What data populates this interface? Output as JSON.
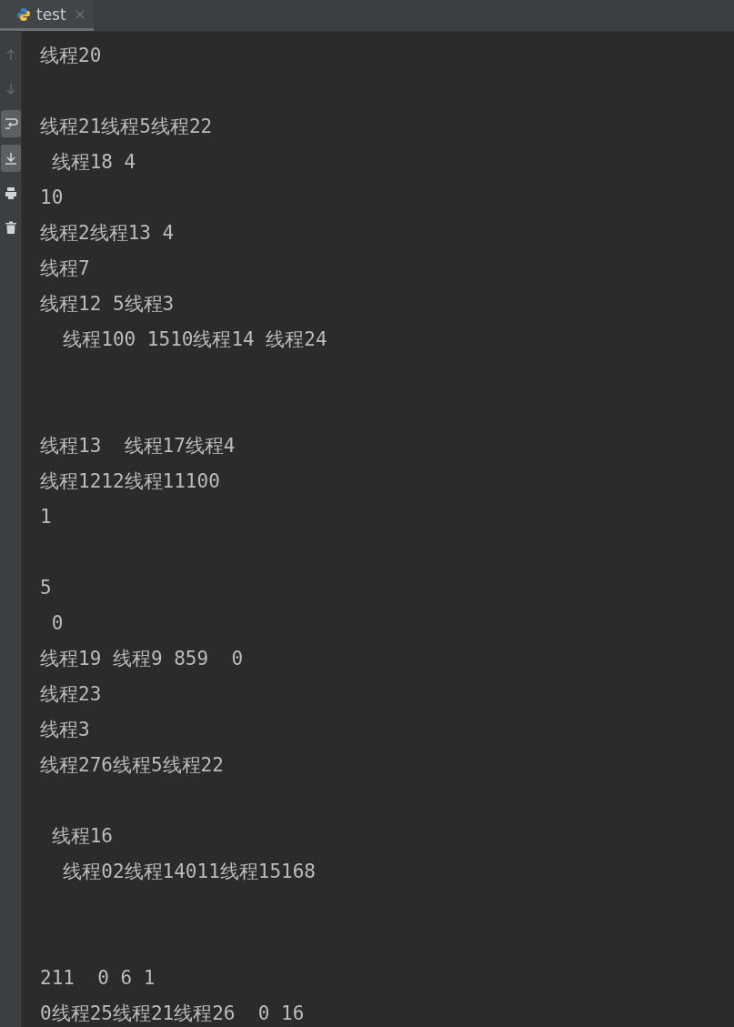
{
  "tab": {
    "label": "test",
    "selected": true
  },
  "toolbar": [
    {
      "kind": "up",
      "disabled": true,
      "on": false
    },
    {
      "kind": "down",
      "disabled": true,
      "on": false
    },
    {
      "kind": "wrap",
      "disabled": false,
      "on": true
    },
    {
      "kind": "scroll-end",
      "disabled": false,
      "on": true
    },
    {
      "kind": "print",
      "disabled": false,
      "on": false
    },
    {
      "kind": "delete",
      "disabled": false,
      "on": false
    }
  ],
  "lines": [
    {
      "kind": "text",
      "text": "线程20"
    },
    {
      "kind": "blank"
    },
    {
      "kind": "text",
      "text": "线程21线程5线程22"
    },
    {
      "kind": "text",
      "text": " 线程18 4"
    },
    {
      "kind": "text",
      "text": "10"
    },
    {
      "kind": "text",
      "text": "线程2线程13 4"
    },
    {
      "kind": "text",
      "text": "线程7"
    },
    {
      "kind": "text",
      "text": "线程12 5线程3"
    },
    {
      "kind": "text",
      "text": "  线程100 1510线程14 线程24"
    },
    {
      "kind": "blank"
    },
    {
      "kind": "blank"
    },
    {
      "kind": "text",
      "text": "线程13  线程17线程4"
    },
    {
      "kind": "text",
      "text": "线程1212线程11100"
    },
    {
      "kind": "text",
      "text": "1"
    },
    {
      "kind": "blank"
    },
    {
      "kind": "text",
      "text": "5"
    },
    {
      "kind": "text",
      "text": " 0"
    },
    {
      "kind": "text",
      "text": "线程19 线程9 859  0"
    },
    {
      "kind": "text",
      "text": "线程23"
    },
    {
      "kind": "text",
      "text": "线程3"
    },
    {
      "kind": "text",
      "text": "线程276线程5线程22"
    },
    {
      "kind": "blank"
    },
    {
      "kind": "text",
      "text": " 线程16"
    },
    {
      "kind": "text",
      "text": "  线程02线程14011线程15168"
    },
    {
      "kind": "blank"
    },
    {
      "kind": "blank"
    },
    {
      "kind": "text",
      "text": "211  0 6 1"
    },
    {
      "kind": "text",
      "text": "0线程25线程21线程26  0 16"
    }
  ]
}
